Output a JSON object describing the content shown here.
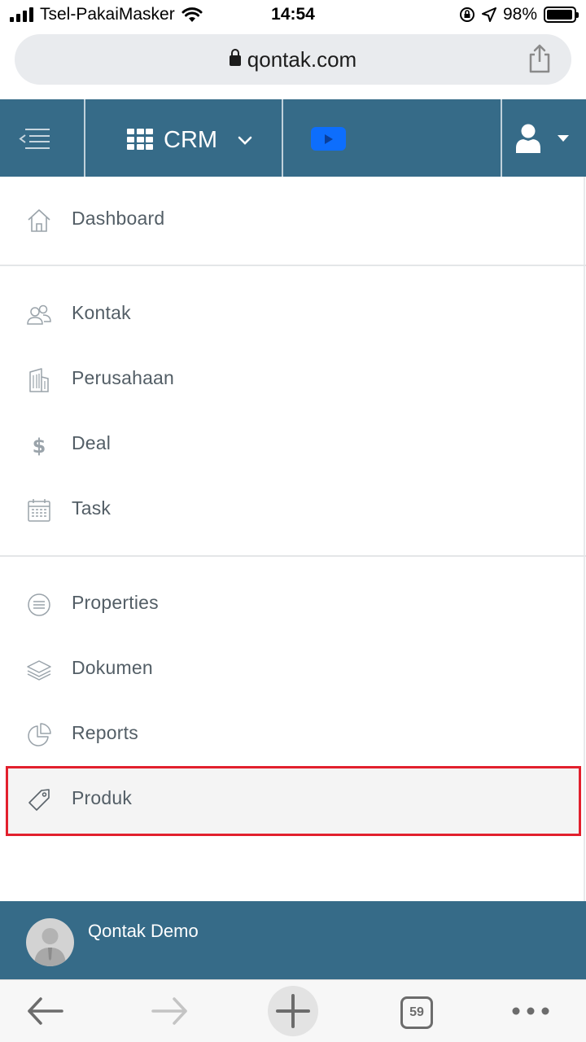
{
  "status_bar": {
    "carrier": "Tsel-PakaiMasker",
    "time": "14:54",
    "battery": "98%",
    "battery_level": 0.98
  },
  "browser": {
    "url": "qontak.com",
    "tab_count": "59"
  },
  "header": {
    "app_switcher_label": "CRM"
  },
  "sidebar": {
    "groups": [
      [
        {
          "label": "Dashboard",
          "icon": "home-icon"
        }
      ],
      [
        {
          "label": "Kontak",
          "icon": "users-icon"
        },
        {
          "label": "Perusahaan",
          "icon": "building-icon"
        },
        {
          "label": "Deal",
          "icon": "dollar-icon"
        },
        {
          "label": "Task",
          "icon": "calendar-icon"
        }
      ],
      [
        {
          "label": "Properties",
          "icon": "list-circle-icon"
        },
        {
          "label": "Dokumen",
          "icon": "layers-icon"
        },
        {
          "label": "Reports",
          "icon": "pie-chart-icon"
        },
        {
          "label": "Produk",
          "icon": "tag-icon"
        }
      ]
    ],
    "highlighted_item": "Produk"
  },
  "footer": {
    "user_name": "Qontak Demo"
  },
  "colors": {
    "header_bg": "#366b88",
    "highlight_border": "#e2202d",
    "video_button": "#0d6efd"
  }
}
